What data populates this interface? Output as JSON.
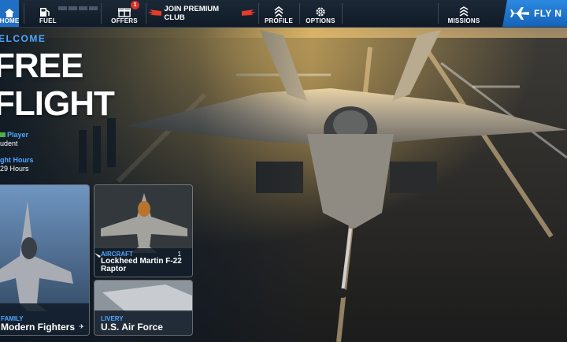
{
  "topbar": {
    "home_label": "HOME",
    "fuel_label": "FUEL",
    "offers_label": "OFFERS",
    "offers_badge": "1",
    "premium_label": "JOIN PREMIUM CLUB",
    "profile_label": "PROFILE",
    "options_label": "OPTIONS",
    "missions_label": "MISSIONS",
    "fly_label": "FLY N"
  },
  "welcome": {
    "heading": "ELCOME",
    "title_line1": "FREE",
    "title_line2": "FLIGHT",
    "player_name": "Player",
    "player_rank": "udent",
    "hours_label": "ght Hours",
    "hours_value": "29 Hours"
  },
  "cards": {
    "family": {
      "category": "FAMILY",
      "name": "Modern Fighters"
    },
    "aircraft": {
      "category": "AIRCRAFT",
      "count": "1",
      "name_line1": "Lockheed Martin F-22",
      "name_line2": "Raptor"
    },
    "livery": {
      "category": "LIVERY",
      "name": "U.S. Air Force"
    }
  },
  "colors": {
    "accent": "#4ea8ff",
    "fly_button": "#1f78d1",
    "badge": "#d8312b"
  }
}
